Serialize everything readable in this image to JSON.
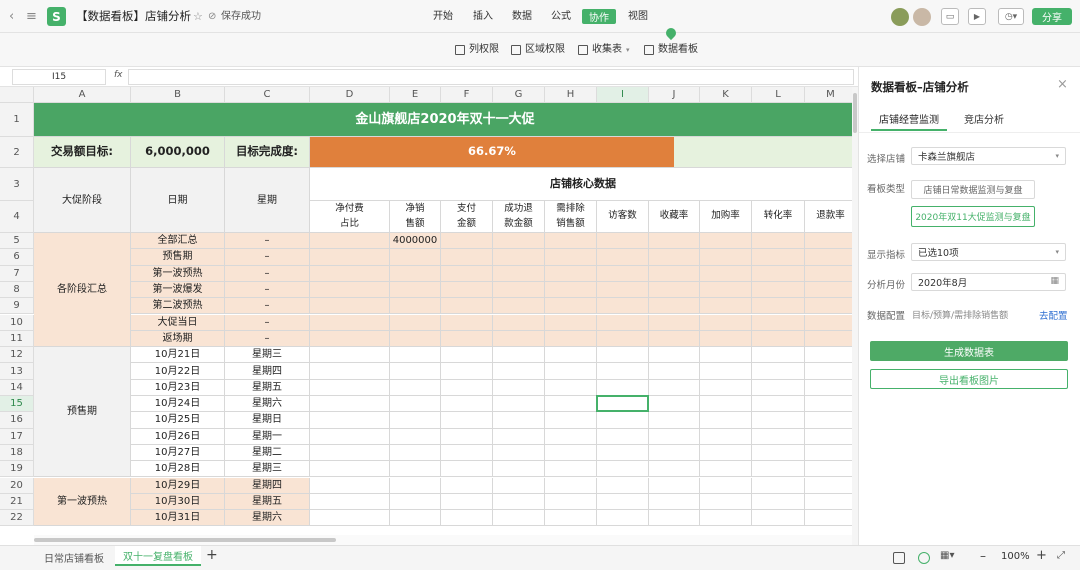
{
  "topbar": {
    "doc_title": "【数据看板】店铺分析",
    "save_status": "保存成功",
    "menus": [
      "开始",
      "插入",
      "数据",
      "公式",
      "协作",
      "视图"
    ],
    "active_menu": "协作",
    "share_label": "分享",
    "accent": "#45b16a"
  },
  "subbar": {
    "items": [
      "列权限",
      "区域权限",
      "收集表",
      "数据看板"
    ]
  },
  "formula": {
    "cell_ref": "I15",
    "fx": "fx",
    "value": ""
  },
  "grid": {
    "columns": [
      "A",
      "B",
      "C",
      "D",
      "E",
      "F",
      "G",
      "H",
      "I",
      "J",
      "K",
      "L",
      "M"
    ],
    "selected_column": "I",
    "row_numbers": [
      "1",
      "2",
      "3",
      "4",
      "5",
      "6",
      "7",
      "8",
      "9",
      "10",
      "11",
      "12",
      "13",
      "14",
      "15",
      "16",
      "17",
      "18",
      "19",
      "20",
      "21",
      "22"
    ],
    "selected_row": "15",
    "title": "金山旗舰店2020年双十一大促",
    "target_label": "交易额目标:",
    "target_value": "6,000,000",
    "completion_label": "目标完成度:",
    "completion_value": "66.67%",
    "completion_fraction": 0.6667,
    "header_stage": "大促阶段",
    "header_date": "日期",
    "header_weekday": "星期",
    "header_core": "店铺核心数据",
    "metrics": [
      "净付费\n占比",
      "净销\n售额",
      "支付\n金额",
      "成功退\n款金额",
      "需排除\n销售额",
      "访客数",
      "收藏率",
      "加购率",
      "转化率",
      "退款率"
    ],
    "group1_name": "各阶段汇总",
    "group2_name": "预售期",
    "group3_name": "第一波预热",
    "rows": [
      {
        "date": "全部汇总",
        "weekday": "–",
        "e": "4000000"
      },
      {
        "date": "预售期",
        "weekday": "–",
        "e": ""
      },
      {
        "date": "第一波预热",
        "weekday": "–",
        "e": ""
      },
      {
        "date": "第一波爆发",
        "weekday": "–",
        "e": ""
      },
      {
        "date": "第二波预热",
        "weekday": "–",
        "e": ""
      },
      {
        "date": "大促当日",
        "weekday": "–",
        "e": ""
      },
      {
        "date": "返场期",
        "weekday": "–",
        "e": ""
      },
      {
        "date": "10月21日",
        "weekday": "星期三",
        "e": ""
      },
      {
        "date": "10月22日",
        "weekday": "星期四",
        "e": ""
      },
      {
        "date": "10月23日",
        "weekday": "星期五",
        "e": ""
      },
      {
        "date": "10月24日",
        "weekday": "星期六",
        "e": ""
      },
      {
        "date": "10月25日",
        "weekday": "星期日",
        "e": ""
      },
      {
        "date": "10月26日",
        "weekday": "星期一",
        "e": ""
      },
      {
        "date": "10月27日",
        "weekday": "星期二",
        "e": ""
      },
      {
        "date": "10月28日",
        "weekday": "星期三",
        "e": ""
      },
      {
        "date": "10月29日",
        "weekday": "星期四",
        "e": ""
      },
      {
        "date": "10月30日",
        "weekday": "星期五",
        "e": ""
      },
      {
        "date": "10月31日",
        "weekday": "星期六",
        "e": ""
      }
    ]
  },
  "panel": {
    "title": "数据看板–店铺分析",
    "tabs": [
      "店铺经营监测",
      "竞店分析"
    ],
    "store_label": "选择店铺",
    "store_value": "卡森兰旗舰店",
    "type_label": "看板类型",
    "type_option1": "店铺日常数据监测与复盘",
    "type_option2": "2020年双11大促监测与复盘",
    "metric_label": "显示指标",
    "metric_value": "已选10项",
    "month_label": "分析月份",
    "month_value": "2020年8月",
    "config_label": "数据配置",
    "config_value": "目标/预算/需排除销售额",
    "config_link": "去配置",
    "generate_btn": "生成数据表",
    "export_btn": "导出看板图片"
  },
  "bottom": {
    "sheets": [
      "日常店铺看板",
      "双十一复盘看板"
    ],
    "active_sheet": "双十一复盘看板",
    "add": "+",
    "zoom": "100%",
    "minus": "–",
    "plus": "+"
  },
  "colors": {
    "green": "#4aa564",
    "orange": "#e0803c",
    "peach": "#f9e4d4",
    "soft_green": "#e6f2de"
  }
}
